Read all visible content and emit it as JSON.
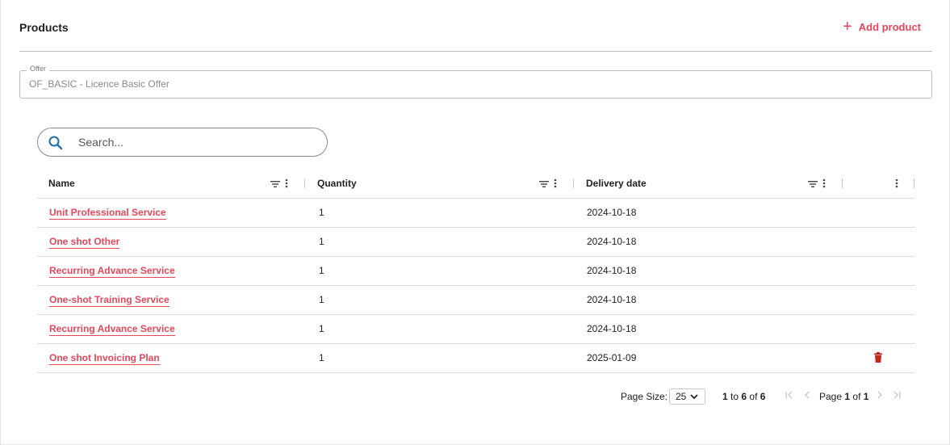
{
  "section": {
    "title": "Products",
    "add_label": "Add product"
  },
  "offer": {
    "legend": "Offer",
    "value": "OF_BASIC - Licence Basic Offer"
  },
  "search": {
    "placeholder": "Search..."
  },
  "grid": {
    "columns": [
      "Name",
      "Quantity",
      "Delivery date",
      ""
    ],
    "rows": [
      {
        "name": "Unit Professional Service",
        "quantity": "1",
        "date": "2024-10-18"
      },
      {
        "name": "One shot Other",
        "quantity": "1",
        "date": "2024-10-18"
      },
      {
        "name": "Recurring Advance Service",
        "quantity": "1",
        "date": "2024-10-18"
      },
      {
        "name": "One-shot Training Service",
        "quantity": "1",
        "date": "2024-10-18"
      },
      {
        "name": "Recurring Advance Service",
        "quantity": "1",
        "date": "2024-10-18"
      },
      {
        "name": "One shot Invoicing Plan",
        "quantity": "1",
        "date": "2025-01-09",
        "delete": "trash-icon"
      }
    ]
  },
  "pager": {
    "page_size_label": "Page Size:",
    "page_size": "25",
    "range_from": "1",
    "range_to_word": "to",
    "range_to": "6",
    "range_of_word": "of",
    "range_total": "6",
    "page_word": "Page",
    "page": "1",
    "of_word": "of",
    "pages": "1"
  },
  "colors": {
    "accent": "#e5475b",
    "delete": "#c0271f",
    "search_icon": "#1f6fa8"
  }
}
